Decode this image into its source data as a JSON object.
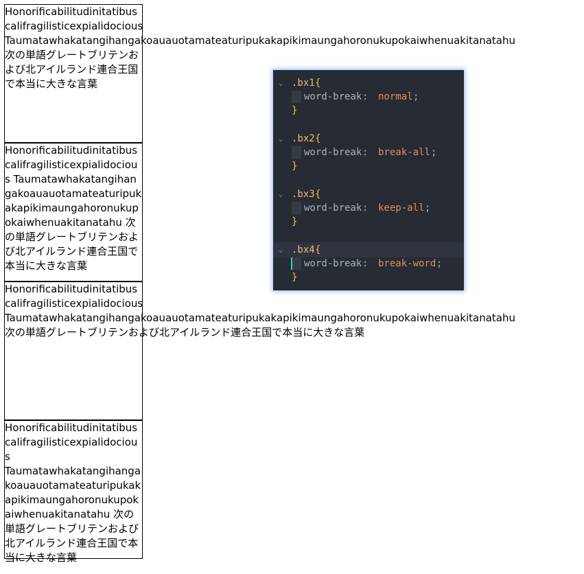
{
  "boxes": [
    {
      "class": "bx1",
      "word1": "Honorificabilitudinitatibus",
      "word2": "califragilisticexpialidocious",
      "word3": "Taumatawhakatangihangakoauauotamateaturipukakapikimaungahoronukupokaiwhenuakitanatahu",
      "japanese": "次の単語グレートブリテンおよび北アイルランド連合王国で本当に大きな言葉"
    },
    {
      "class": "bx2",
      "word1": "Honorificabilitudinitatibus",
      "word2": "califragilisticexpialidocious",
      "word3": "Taumatawhakatangihangakoauauotamateaturipukakapikimaungahoronukupokaiwhenuakitanatahu",
      "japanese": "次の単語グレートブリテンおよび北アイルランド連合王国で本当に大きな言葉"
    },
    {
      "class": "bx3",
      "word1": "Honorificabilitudinitatibus",
      "word2": "califragilisticexpialidocious",
      "word3": "Taumatawhakatangihangakoauauotamateaturipukakapikimaungahoronukupokaiwhenuakitanatahu",
      "japanese": "次の単語グレートブリテンおよび北アイルランド連合王国で本当に大きな言葉"
    },
    {
      "class": "bx4",
      "word1": "Honorificabilitudinitatibus",
      "word2": "califragilisticexpialidocious",
      "word3": "Taumatawhakatangihangakoauauotamateaturipukakapikimaungahoronukupokaiwhenuakitanatahu",
      "japanese": "次の単語グレートブリテンおよび北アイルランド連合王国で本当に大きな言葉"
    }
  ],
  "code": {
    "rules": [
      {
        "selector": ".bx1",
        "open": "{",
        "property": "word-break",
        "colon": ":",
        "value": "normal",
        "semi": ";",
        "close": "}"
      },
      {
        "selector": ".bx2",
        "open": "{",
        "property": "word-break",
        "colon": ":",
        "value": "break-all",
        "semi": ";",
        "close": "}"
      },
      {
        "selector": ".bx3",
        "open": "{",
        "property": "word-break",
        "colon": ":",
        "value": "keep-all",
        "semi": ";",
        "close": "}"
      },
      {
        "selector": ".bx4",
        "open": "{",
        "property": "word-break",
        "colon": ":",
        "value": "break-word",
        "semi": ";",
        "close": "}"
      }
    ],
    "fold_icon": "chevron-down-icon",
    "colors": {
      "background": "#272b33",
      "selector": "#e5c07b",
      "brace": "#f0c040",
      "property": "#abb2bf",
      "value": "#e08f5d",
      "cursor": "#2bd4b4"
    }
  }
}
